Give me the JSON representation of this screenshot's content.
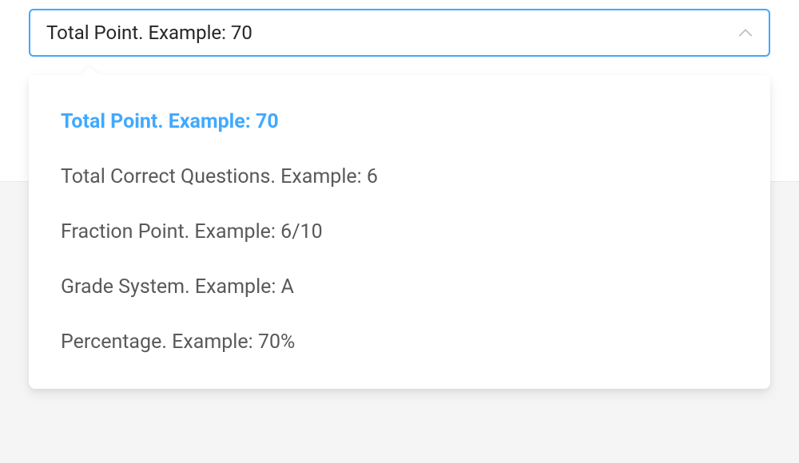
{
  "select": {
    "value": "Total Point. Example: 70",
    "options": [
      {
        "label": "Total Point. Example: 70",
        "selected": true
      },
      {
        "label": "Total Correct Questions. Example: 6",
        "selected": false
      },
      {
        "label": "Fraction Point. Example: 6/10",
        "selected": false
      },
      {
        "label": "Grade System. Example: A",
        "selected": false
      },
      {
        "label": "Percentage. Example: 70%",
        "selected": false
      }
    ]
  }
}
